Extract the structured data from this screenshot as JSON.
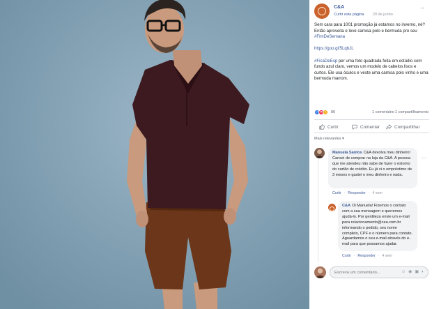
{
  "post": {
    "page_name": "C&A",
    "follow_label": "Curtir esta página",
    "date": "20 de junho",
    "more_glyph": "···",
    "text_p1": "Sem cara para 1001 promoção já estamos no inverno, né? Então aproveita e leve camisa polo e bermuda pro seu",
    "text_p1_link": "#FimDeSemana",
    "text_p2_link": "https://goo.gl/5LqbJL",
    "text_p3_tag": "#FicaDeEsp",
    "text_p3": "per uma foto quadrada feita em estúdio com fundo azul claro, vemos um modelo de cabelos lisos e curtos. Ele usa óculos e veste uma camisa polo vinho e uma bermuda marrom."
  },
  "reactions": {
    "count": "86",
    "comments": "1 comentário",
    "shares": "1 compartilhamento"
  },
  "actions": {
    "like": "Curtir",
    "comment": "Comentar",
    "share": "Compartilhar"
  },
  "comments_filter": "Mais relevantes ▾",
  "comments": [
    {
      "author": "Manuela Santos",
      "text": "C&A devolva meu dinheiro! Cansei de comprar na loja da C&A. A pessoa que me atendeu não sabe de fazer o estorno do cartão de crédito. Eu já vi o empréstimo de 3 meses e gastei o meu dinheiro e nada.",
      "like": "Curtir",
      "reply": "Responder",
      "time": "4 sem"
    },
    {
      "author": "C&A",
      "text": "Oi Manuela! Fizemos o contato com a sua mensagem e queremos ajudá-lo. Por gentileza envie um e-mail para relacionamento@cea.com.br informando o pedido, seu nome completo, CPF e o número para contato. Aguardamos o seu e-mail através do e-mail para que possamos ajudar.",
      "like": "Curtir",
      "reply": "Responder",
      "time": "4 sem"
    }
  ],
  "composer": {
    "placeholder": "Escreva um comentário...",
    "icons": [
      "emoji-icon",
      "camera-icon",
      "gif-icon",
      "sticker-icon"
    ]
  },
  "colors": {
    "backdrop": "#7f9eb2",
    "shirt": "#3d1a1f",
    "shorts": "#6b3619",
    "link": "#385898",
    "brand": "#c9622d"
  }
}
